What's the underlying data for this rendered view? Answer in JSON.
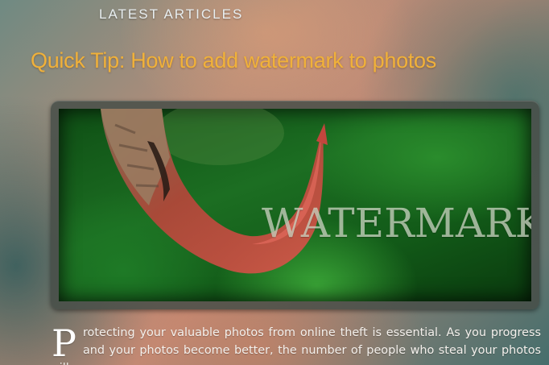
{
  "section": {
    "heading": "LATEST ARTICLES"
  },
  "article": {
    "title": "Quick Tip: How to add watermark to photos",
    "image": {
      "watermark_text": "WATERMARK"
    },
    "drop_cap": "P",
    "body_text": "rotecting your valuable photos from online theft is essential. As you progress and your photos become better, the number of people who steal your photos will"
  },
  "colors": {
    "title": "#f0b13a",
    "heading": "#e8eef0",
    "body_text": "#f4f0ec"
  }
}
